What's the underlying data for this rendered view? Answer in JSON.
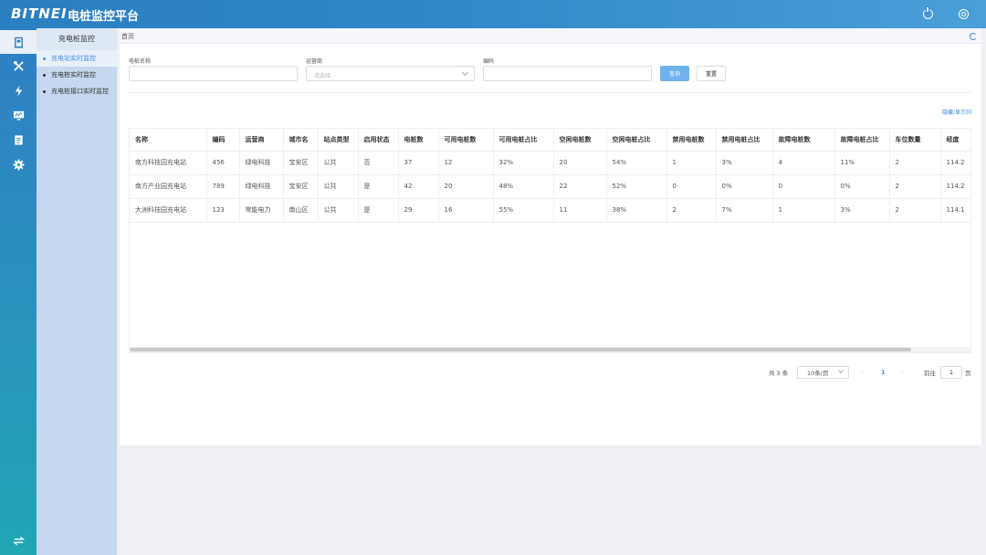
{
  "header": {
    "logo": "BITNEI",
    "title": "电桩监控平台"
  },
  "rail": {
    "items": [
      "station-icon",
      "tools-icon",
      "bolt-icon",
      "monitor-icon",
      "document-icon",
      "gear-icon"
    ],
    "bottom_icon": "switch-icon"
  },
  "submenu": {
    "title": "充电桩监控",
    "items": [
      {
        "label": "充电站实时监控"
      },
      {
        "label": "充电桩实时监控"
      },
      {
        "label": "充电桩接口实时监控"
      }
    ]
  },
  "tabs": {
    "home": "首页"
  },
  "filters": {
    "name_label": "电桩名称",
    "operator_label": "运营商",
    "operator_placeholder": "请选择",
    "code_label": "编码",
    "query_button": "查询",
    "reset_button": "重置"
  },
  "column_toggle": "隐藏/显示列",
  "table": {
    "headers": [
      "名称",
      "编码",
      "运营商",
      "城市名",
      "站点类型",
      "启用状态",
      "电桩数",
      "可用电桩数",
      "可用电桩占比",
      "空闲电桩数",
      "空闲电桩占比",
      "禁用电桩数",
      "禁用电桩占比",
      "故障电桩数",
      "故障电桩占比",
      "车位数量",
      "经度"
    ],
    "rows": [
      [
        "南方科技园充电站",
        "456",
        "绿电科技",
        "宝安区",
        "公共",
        "否",
        "37",
        "12",
        "32%",
        "20",
        "54%",
        "1",
        "3%",
        "4",
        "11%",
        "2",
        "114.2"
      ],
      [
        "南方产业园充电站",
        "789",
        "绿电科技",
        "宝安区",
        "公共",
        "是",
        "42",
        "20",
        "48%",
        "22",
        "52%",
        "0",
        "0%",
        "0",
        "0%",
        "2",
        "114.2"
      ],
      [
        "大洲科技园充电站",
        "123",
        "常能电力",
        "南山区",
        "公共",
        "是",
        "29",
        "16",
        "55%",
        "11",
        "38%",
        "2",
        "7%",
        "1",
        "3%",
        "2",
        "114.1"
      ]
    ]
  },
  "pagination": {
    "total": "共 3 条",
    "page_size": "10条/页",
    "prev": "‹",
    "current_page": "1",
    "next": "›",
    "goto_label": "前往",
    "goto_value": "1",
    "unit": "页"
  }
}
